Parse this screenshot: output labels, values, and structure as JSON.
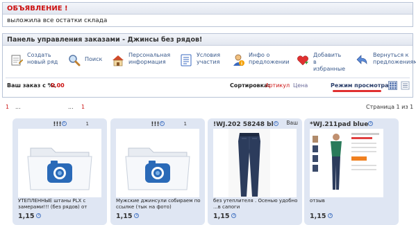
{
  "announcement": {
    "title": "ОБЪЯВЛЕНИЕ !",
    "text": "выложила все остатки склада"
  },
  "panel": {
    "title": "Панель управления заказами - Джинсы без рядов!",
    "tools": [
      {
        "label_1": "Создать",
        "label_2": "новый ряд",
        "icon": "create-row-icon"
      },
      {
        "label_1": "Поиск",
        "label_2": "",
        "icon": "search-icon"
      },
      {
        "label_1": "Персональная",
        "label_2": "информация",
        "icon": "personal-info-icon"
      },
      {
        "label_1": "Условия",
        "label_2": "участия",
        "icon": "conditions-icon"
      },
      {
        "label_1": "Инфо о",
        "label_2": "предложении",
        "icon": "offer-info-icon"
      },
      {
        "label_1": "Добавить",
        "label_2": "в",
        "label_3": "избранные",
        "icon": "favorite-heart-icon"
      },
      {
        "label_1": "Вернуться к",
        "label_2": "предложениям",
        "icon": "back-arrow-icon"
      }
    ],
    "order_label": "Ваш заказ с %:",
    "order_value": "0,00",
    "sort_label": "Сортировка:",
    "sort_option_1": "Артикул",
    "sort_option_2": "Цена",
    "view_label": "Режим просмотра:"
  },
  "pagination": {
    "left_first": "1",
    "left_dots": "...",
    "mid_dots": "...",
    "mid_last": "1",
    "page_info": "Страница 1 из 1"
  },
  "cards": [
    {
      "title": "!!!",
      "count": "1",
      "extra": "",
      "desc": "УТЕПЛЕННЫЕ штаны PLX с замерами!!! (без рядов) от",
      "price": "1,15",
      "image": "folder-camera-icon"
    },
    {
      "title": "!!!",
      "count": "1",
      "extra": "",
      "desc": "Мужские джинсули собираем по ссылке (тык на фото)",
      "price": "1,15",
      "image": "folder-camera-icon"
    },
    {
      "title": "!WJ.202 58248 bl",
      "count": "",
      "extra": "Ваш",
      "desc": "без утеплителя . Осенью удобно ...в сапоги",
      "price": "1,15",
      "image": "jeans-photo"
    },
    {
      "title": "*WJ.211pad blue",
      "count": "",
      "extra": "",
      "desc": "отзыв",
      "price": "1,15",
      "image": "product-page-photo"
    }
  ],
  "colors": {
    "accent_red": "#cc1111",
    "link_blue": "#3a5a8c",
    "card_bg": "#dfe6f3",
    "header_bg": "#e2e7f0"
  }
}
